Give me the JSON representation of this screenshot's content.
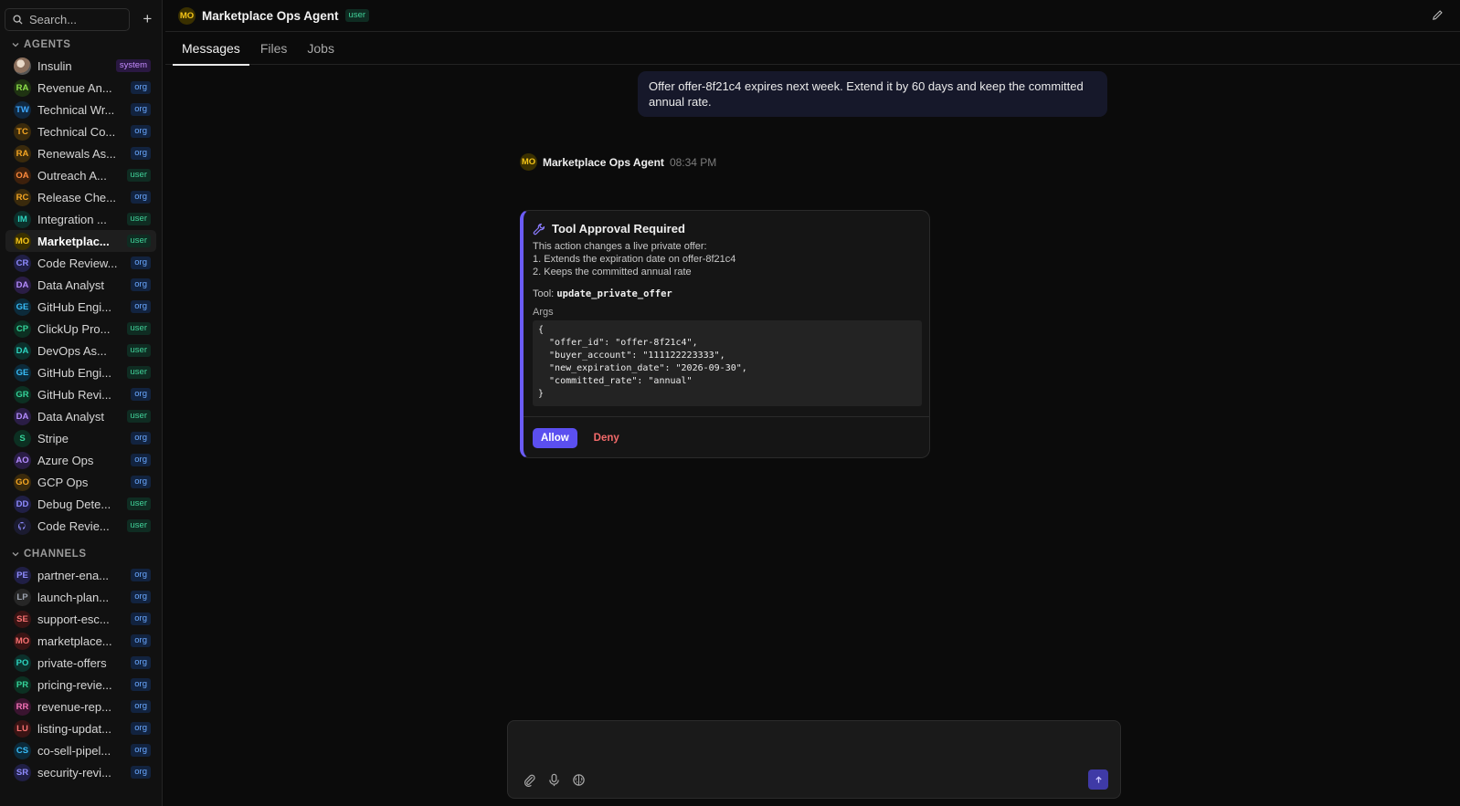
{
  "sidebar": {
    "search_placeholder": "Search...",
    "add_label": "+",
    "agents_header": "AGENTS",
    "channels_header": "CHANNELS",
    "agents": [
      {
        "initials": "",
        "label": "Insulin",
        "badge": "system",
        "badge_type": "system",
        "color": "#e0e0e0",
        "bg": "#333"
      },
      {
        "initials": "RA",
        "label": "Revenue An...",
        "badge": "org",
        "badge_type": "org",
        "color": "#8ee04a",
        "bg": "#1f3312"
      },
      {
        "initials": "TW",
        "label": "Technical Wr...",
        "badge": "org",
        "badge_type": "org",
        "color": "#3fa9ff",
        "bg": "#102840"
      },
      {
        "initials": "TC",
        "label": "Technical Co...",
        "badge": "org",
        "badge_type": "org",
        "color": "#f5a623",
        "bg": "#3a2a0c"
      },
      {
        "initials": "RA",
        "label": "Renewals As...",
        "badge": "org",
        "badge_type": "org",
        "color": "#f5a623",
        "bg": "#3a2a0c"
      },
      {
        "initials": "OA",
        "label": "Outreach A...",
        "badge": "user",
        "badge_type": "user",
        "color": "#ff8a3d",
        "bg": "#3d200c"
      },
      {
        "initials": "RC",
        "label": "Release Che...",
        "badge": "org",
        "badge_type": "org",
        "color": "#f5a623",
        "bg": "#3a2a0c"
      },
      {
        "initials": "IM",
        "label": "Integration ...",
        "badge": "user",
        "badge_type": "user",
        "color": "#2dd4bf",
        "bg": "#0c302b"
      },
      {
        "initials": "MO",
        "label": "Marketplac...",
        "badge": "user",
        "badge_type": "user",
        "color": "#f5c518",
        "bg": "#3a3000",
        "active": true
      },
      {
        "initials": "CR",
        "label": "Code Review...",
        "badge": "org",
        "badge_type": "org",
        "color": "#8f8cff",
        "bg": "#201f45"
      },
      {
        "initials": "DA",
        "label": "Data Analyst",
        "badge": "org",
        "badge_type": "org",
        "color": "#b48cff",
        "bg": "#2a1d45"
      },
      {
        "initials": "GE",
        "label": "GitHub Engi...",
        "badge": "org",
        "badge_type": "org",
        "color": "#38bdf8",
        "bg": "#0c2a3a"
      },
      {
        "initials": "CP",
        "label": "ClickUp Pro...",
        "badge": "user",
        "badge_type": "user",
        "color": "#34d399",
        "bg": "#0c3022"
      },
      {
        "initials": "DA",
        "label": "DevOps As...",
        "badge": "user",
        "badge_type": "user",
        "color": "#2dd4bf",
        "bg": "#0c302b"
      },
      {
        "initials": "GE",
        "label": "GitHub Engi...",
        "badge": "user",
        "badge_type": "user",
        "color": "#38bdf8",
        "bg": "#0c2a3a"
      },
      {
        "initials": "GR",
        "label": "GitHub Revi...",
        "badge": "org",
        "badge_type": "org",
        "color": "#34d399",
        "bg": "#0c3022"
      },
      {
        "initials": "DA",
        "label": "Data Analyst",
        "badge": "user",
        "badge_type": "user",
        "color": "#b48cff",
        "bg": "#2a1d45"
      },
      {
        "initials": "S",
        "label": "Stripe",
        "badge": "org",
        "badge_type": "org",
        "color": "#34d399",
        "bg": "#0c3022"
      },
      {
        "initials": "AO",
        "label": "Azure Ops",
        "badge": "org",
        "badge_type": "org",
        "color": "#b48cff",
        "bg": "#2a1d45"
      },
      {
        "initials": "GO",
        "label": "GCP Ops",
        "badge": "org",
        "badge_type": "org",
        "color": "#f5a623",
        "bg": "#3a2a0c"
      },
      {
        "initials": "DD",
        "label": "Debug Dete...",
        "badge": "user",
        "badge_type": "user",
        "color": "#8f8cff",
        "bg": "#201f45"
      },
      {
        "initials": "",
        "label": "Code Revie...",
        "badge": "user",
        "badge_type": "user",
        "color": "#8f8cff",
        "bg": "#1b1b30",
        "icon": "github-icon"
      }
    ],
    "channels": [
      {
        "initials": "PE",
        "label": "partner-ena...",
        "badge": "org",
        "color": "#8f8cff",
        "bg": "#201f45"
      },
      {
        "initials": "LP",
        "label": "launch-plan...",
        "badge": "org",
        "color": "#9ca3af",
        "bg": "#262626"
      },
      {
        "initials": "SE",
        "label": "support-esc...",
        "badge": "org",
        "color": "#f87171",
        "bg": "#3a1414"
      },
      {
        "initials": "MO",
        "label": "marketplace...",
        "badge": "org",
        "color": "#f87171",
        "bg": "#3a1414"
      },
      {
        "initials": "PO",
        "label": "private-offers",
        "badge": "org",
        "color": "#2dd4bf",
        "bg": "#0c302b"
      },
      {
        "initials": "PR",
        "label": "pricing-revie...",
        "badge": "org",
        "color": "#34d399",
        "bg": "#0c3022"
      },
      {
        "initials": "RR",
        "label": "revenue-rep...",
        "badge": "org",
        "color": "#f472b6",
        "bg": "#3a1430"
      },
      {
        "initials": "LU",
        "label": "listing-updat...",
        "badge": "org",
        "color": "#f87171",
        "bg": "#3a1414"
      },
      {
        "initials": "CS",
        "label": "co-sell-pipel...",
        "badge": "org",
        "color": "#38bdf8",
        "bg": "#0c2a3a"
      },
      {
        "initials": "SR",
        "label": "security-revi...",
        "badge": "org",
        "color": "#8f8cff",
        "bg": "#201f45"
      }
    ]
  },
  "header": {
    "avatar_initials": "MO",
    "title": "Marketplace Ops Agent",
    "badge": "user"
  },
  "tabs": [
    {
      "label": "Messages",
      "active": true
    },
    {
      "label": "Files"
    },
    {
      "label": "Jobs"
    }
  ],
  "conversation": {
    "user_message": "Offer offer-8f21c4 expires next week. Extend it by 60 days and keep the committed annual rate.",
    "agent_initials": "MO",
    "agent_name": "Marketplace Ops Agent",
    "agent_time": "08:34 PM"
  },
  "approval": {
    "title": "Tool Approval Required",
    "desc_line1": "This action changes a live private offer:",
    "desc_line2": "1. Extends the expiration date on offer-8f21c4",
    "desc_line3": "2. Keeps the committed annual rate",
    "tool_prefix": "Tool:",
    "tool_name": "update_private_offer",
    "args_label": "Args",
    "args_json": "{\n  \"offer_id\": \"offer-8f21c4\",\n  \"buyer_account\": \"111122223333\",\n  \"new_expiration_date\": \"2026-09-30\",\n  \"committed_rate\": \"annual\"\n}",
    "allow_label": "Allow",
    "deny_label": "Deny"
  },
  "composer": {
    "placeholder": "",
    "value": ""
  },
  "colors": {
    "accent": "#5b4ff0",
    "deny": "#f36a6a",
    "approval_border": "#6b5cf6"
  }
}
